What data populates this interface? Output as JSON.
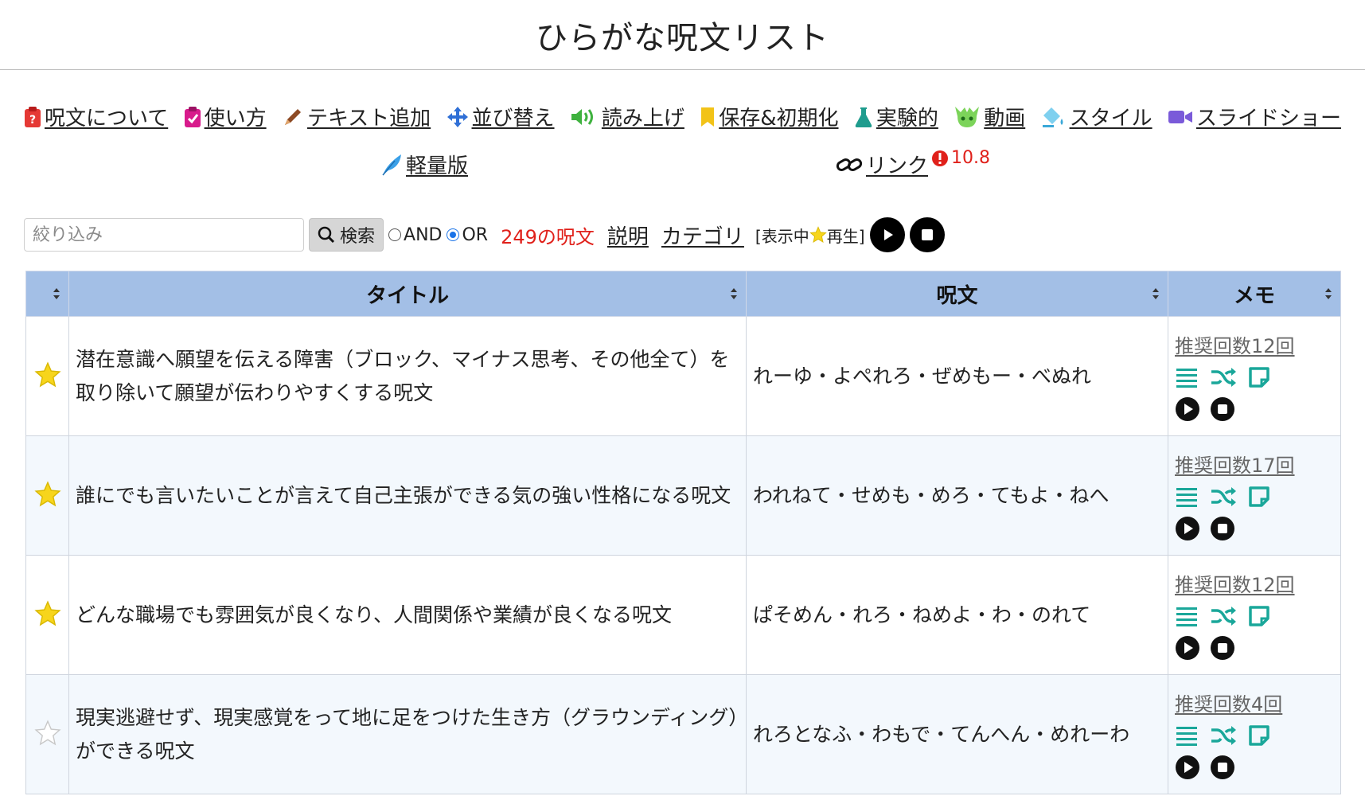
{
  "page": {
    "title": "ひらがな呪文リスト"
  },
  "menu": {
    "items": [
      {
        "label": "呪文について",
        "icon": "question-clipboard-icon"
      },
      {
        "label": "使い方",
        "icon": "check-clipboard-icon"
      },
      {
        "label": "テキスト追加",
        "icon": "pencil-icon"
      },
      {
        "label": "並び替え",
        "icon": "move-arrows-icon"
      },
      {
        "label": "読み上げ",
        "icon": "speaker-icon"
      },
      {
        "label": "保存&初期化",
        "icon": "bookmark-icon"
      },
      {
        "label": "実験的",
        "icon": "flask-icon"
      },
      {
        "label": "動画",
        "icon": "character-face-icon"
      },
      {
        "label": "スタイル",
        "icon": "paint-bucket-icon"
      },
      {
        "label": "スライドショー",
        "icon": "video-camera-icon"
      }
    ],
    "lite": {
      "label": "軽量版",
      "icon": "feather-icon"
    },
    "link": {
      "label": "リンク",
      "icon": "link-icon"
    },
    "version": "10.8",
    "colors": {
      "question": "#e53935",
      "check": "#d81b8c",
      "move": "#2f6fd6",
      "speaker": "#3fb23f",
      "bookmark": "#f2c318",
      "flask": "#1f9c8e",
      "camera": "#7a5ad9",
      "feather": "#3ba0e8"
    }
  },
  "search": {
    "placeholder": "絞り込み",
    "button_label": "検索",
    "mode_and": "AND",
    "mode_or": "OR",
    "selected_mode": "OR",
    "count_text": "249の呪文",
    "explain_label": "説明",
    "category_label": "カテゴリ",
    "playback_prefix": "[表示中",
    "playback_suffix": "再生]"
  },
  "table": {
    "headers": {
      "star": "",
      "title": "タイトル",
      "spell": "呪文",
      "memo": "メモ"
    },
    "rows": [
      {
        "favorite": true,
        "title": "潜在意識へ願望を伝える障害（ブロック、マイナス思考、その他全て）を取り除いて願望が伝わりやすくする呪文",
        "spell": "れーゆ・よぺれろ・ぜめもー・べぬれ",
        "memo": "推奨回数12回"
      },
      {
        "favorite": true,
        "title": "誰にでも言いたいことが言えて自己主張ができる気の強い性格になる呪文",
        "spell": "われねて・せめも・めろ・てもよ・ねへ",
        "memo": "推奨回数17回"
      },
      {
        "favorite": true,
        "title": "どんな職場でも雰囲気が良くなり、人間関係や業績が良くなる呪文",
        "spell": "ぱそめん・れろ・ねめよ・わ・のれて",
        "memo": "推奨回数12回"
      },
      {
        "favorite": false,
        "title": "現実逃避せず、現実感覚をって地に足をつけた生き方（グラウンディング）ができる呪文",
        "spell": "れろとなふ・わもで・てんへん・めれーわ",
        "memo": "推奨回数4回"
      }
    ],
    "colors": {
      "header_bg": "#a3bfe6",
      "star": "#f7d51c",
      "memo_icon": "#1aa79a"
    }
  }
}
